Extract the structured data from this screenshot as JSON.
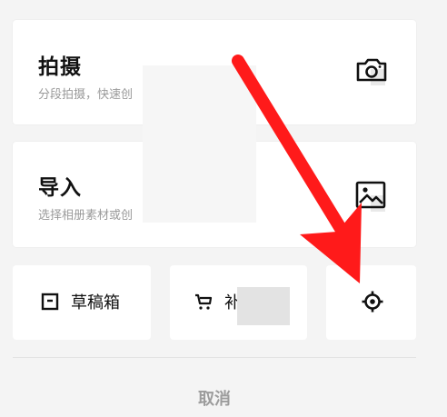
{
  "shoot": {
    "title": "拍摄",
    "subtitle": "分段拍摄，快速创",
    "icon": "camera-icon"
  },
  "import": {
    "title": "导入",
    "subtitle": "选择相册素材或创",
    "icon": "image-icon"
  },
  "actions": [
    {
      "label": "草稿箱",
      "icon": "drafts-icon"
    },
    {
      "label": "补",
      "icon": "cart-icon"
    },
    {
      "label": "",
      "icon": "settings-icon"
    }
  ],
  "footer": {
    "cancel": "取消"
  },
  "annotation": {
    "arrow_color": "#ff1a1a"
  }
}
